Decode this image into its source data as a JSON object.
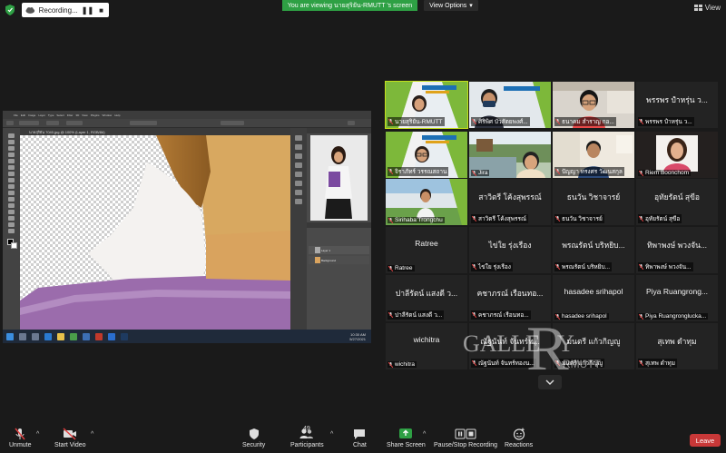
{
  "topbar": {
    "recording_label": "Recording...",
    "pause_glyph": "❚❚",
    "stop_glyph": "■",
    "viewing_banner": "You are viewing นายสุริยัน-RMUTT 's screen",
    "view_options_label": "View Options",
    "view_label": "View",
    "banner_color": "#2ea044"
  },
  "shared_screen": {
    "document_tab": "นายสุริยัน 7040.jpg @ 100% (Layer 1, RGB/8#)",
    "menu_items": [
      "File",
      "Edit",
      "Image",
      "Layer",
      "Type",
      "Select",
      "Filter",
      "3D",
      "View",
      "Plugins",
      "Window",
      "Help"
    ],
    "layers": [
      "Layer 1",
      "Background"
    ],
    "clock_time": "10:30 AM",
    "clock_date": "5/27/2021"
  },
  "participants": [
    {
      "name": "นายสุริยัน-RMUTT",
      "mode": "video",
      "active": true
    },
    {
      "name": "ศิริพิศ บัวสัตยพงศ์...",
      "mode": "video"
    },
    {
      "name": "ธนาคม สำราญ กอ...",
      "mode": "video"
    },
    {
      "name": "พรรพร ปำหรุ่น ว...",
      "mode": "name",
      "big": "พรรพร ปำหรุ่น ว..."
    },
    {
      "name": "จิราภัทร์ วรรณสถาน",
      "mode": "video"
    },
    {
      "name": "Jira",
      "mode": "video"
    },
    {
      "name": "ปัญญา ทรงศร วัฒนสกุล",
      "mode": "video"
    },
    {
      "name": "Riem Boonchom",
      "mode": "video"
    },
    {
      "name": "Sirihaba Trongchu",
      "mode": "video"
    },
    {
      "name": "สาวิตรี โค้งสุพรรณ์",
      "mode": "name",
      "big": "สาวิตรี โค้งสุพรรณ์"
    },
    {
      "name": "ธนวัน วิชาจารย์",
      "mode": "name",
      "big": "ธนวัน วิชาจารย์"
    },
    {
      "name": "อุทัยรัตน์ สุขีอ",
      "mode": "name",
      "big": "อุทัยรัตน์ สุขีอ"
    },
    {
      "name": "Ratree",
      "mode": "name",
      "big": "Ratree"
    },
    {
      "name": "ไข่ใย รุ่งเรือง",
      "mode": "name",
      "big": "ไข่ใย รุ่งเรือง"
    },
    {
      "name": "พรณรัตน์ บริหยิบ...",
      "mode": "name",
      "big": "พรณรัตน์ บริหยิบ..."
    },
    {
      "name": "ทิพาพงษ์ พวงจัน...",
      "mode": "name",
      "big": "ทิพาพงษ์ พวงจัน..."
    },
    {
      "name": "ปาลีรัตน์ แสงดี ว...",
      "mode": "name",
      "big": "ปาลีรัตน์ แสงดี ว..."
    },
    {
      "name": "คชาภรณ์ เรือนทอ...",
      "mode": "name",
      "big": "คชาภรณ์ เรือนทอ..."
    },
    {
      "name": "hasadee srihapol",
      "mode": "name",
      "big": "hasadee srihapol"
    },
    {
      "name": "Piya Ruangronglucka...",
      "mode": "name",
      "big": "Piya Ruangrong..."
    },
    {
      "name": "wichitra",
      "mode": "name",
      "big": "wichitra"
    },
    {
      "name": "ณัฐนันท์ จันทร์ทองน...",
      "mode": "name",
      "big": "ณัฐนันท์ จันทร์ท..."
    },
    {
      "name": "มนตรี แก้วกิญญู",
      "mode": "name",
      "big": "มนตรี แก้วกิญญู"
    },
    {
      "name": "สุเทพ ดำทุม",
      "mode": "name",
      "big": "สุเทพ ดำทุม"
    }
  ],
  "watermark": {
    "part1": "GALLE",
    "letter": "R",
    "part2": "Y",
    "sub": "RMUTT"
  },
  "toolbar": {
    "unmute": "Unmute",
    "start_video": "Start Video",
    "security": "Security",
    "participants": "Participants",
    "participant_count": "49",
    "chat": "Chat",
    "share_screen": "Share Screen",
    "recording": "Pause/Stop Recording",
    "reactions": "Reactions",
    "leave": "Leave",
    "leave_color": "#c83838",
    "share_color": "#2ea044"
  }
}
